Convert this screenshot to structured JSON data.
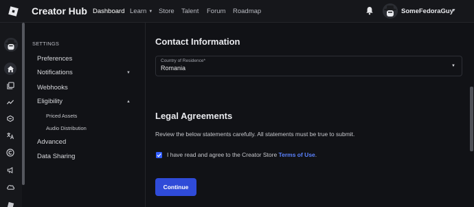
{
  "topbar": {
    "brand": "Creator Hub",
    "nav": [
      {
        "label": "Dashboard"
      },
      {
        "label": "Learn"
      },
      {
        "label": "Store"
      },
      {
        "label": "Talent"
      },
      {
        "label": "Forum"
      },
      {
        "label": "Roadmap"
      }
    ],
    "username": "SomeFedoraGuy"
  },
  "rail": {
    "icons": [
      "home-icon",
      "gallery-icon",
      "analytics-icon",
      "sales-icon",
      "translate-icon",
      "copyright-icon",
      "megaphone-icon",
      "cloud-icon"
    ]
  },
  "sidebar": {
    "heading": "SETTINGS",
    "items": [
      {
        "label": "Preferences"
      },
      {
        "label": "Notifications"
      },
      {
        "label": "Webhooks"
      },
      {
        "label": "Eligibility"
      },
      {
        "label": "Priced Assets"
      },
      {
        "label": "Audio Distribution"
      },
      {
        "label": "Advanced"
      },
      {
        "label": "Data Sharing"
      }
    ]
  },
  "main": {
    "contact_heading": "Contact Information",
    "country_label": "Country of Residence*",
    "country_value": "Romania",
    "legal_heading": "Legal Agreements",
    "review_text": "Review the below statements carefully. All statements must be true to submit.",
    "agree_prefix": "I have read and agree to the Creator Store ",
    "agree_link": "Terms of Use",
    "agree_suffix": ".",
    "agree_checked": true,
    "continue_label": "Continue"
  },
  "colors": {
    "background": "#111216",
    "accent": "#335fff",
    "link": "#5a82ff",
    "button": "#2f4bd8"
  }
}
